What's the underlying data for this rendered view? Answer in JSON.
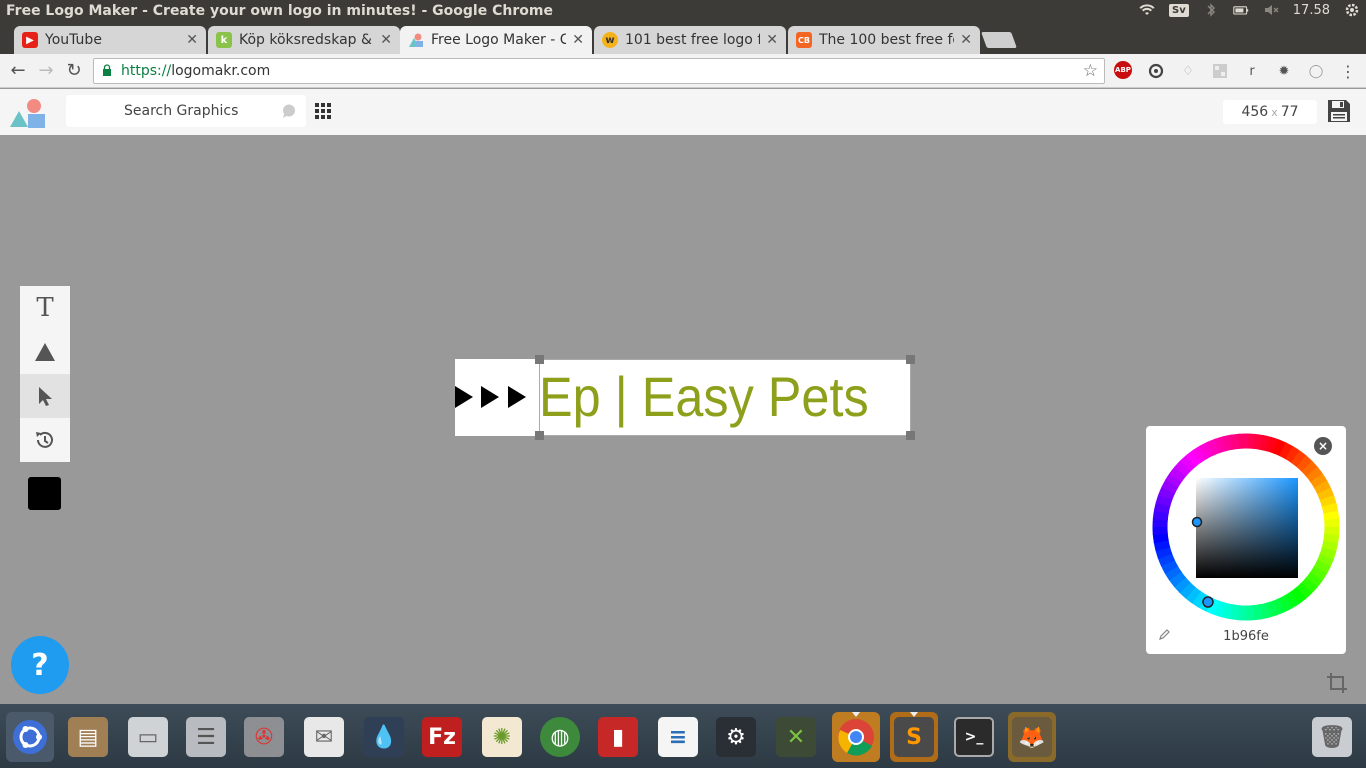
{
  "os": {
    "window_title": "Free Logo Maker - Create your own logo in minutes! - Google Chrome",
    "keyboard_layout": "Sv",
    "clock": "17.58"
  },
  "tabs": [
    {
      "label": "YouTube",
      "favicon": "youtube-icon",
      "color": "#e62117",
      "active": false
    },
    {
      "label": "Köp köksredskap &",
      "favicon": "k-icon",
      "color": "#8bc34a",
      "active": false
    },
    {
      "label": "Free Logo Maker - C",
      "favicon": "logomakr-icon",
      "color": "#f5f5f5",
      "active": true
    },
    {
      "label": "101 best free logo f",
      "favicon": "w-icon",
      "color": "#f6b21b",
      "active": false
    },
    {
      "label": "The 100 best free fo",
      "favicon": "cb-icon",
      "color": "#f26522",
      "active": false
    }
  ],
  "address_bar": {
    "scheme": "https://",
    "host": "logomakr.com"
  },
  "app": {
    "search_placeholder": "Search Graphics",
    "canvas_width": "456",
    "canvas_height": "77",
    "size_separator": "x",
    "logo_text": "Ep | Easy Pets",
    "logo_text_color": "#8ea01b",
    "help_label": "?",
    "swatch_color": "#000000"
  },
  "color_picker": {
    "hex": "1b96fe",
    "close_label": "×"
  },
  "dock_apps": [
    "ubuntu-dash-icon",
    "files-icon",
    "disk-icon",
    "server-icon",
    "settings-tools-icon",
    "mail-icon",
    "droplet-icon",
    "filezilla-icon",
    "brightness-icon",
    "globe-icon",
    "book-icon",
    "writer-icon",
    "steam-icon",
    "xmind-icon",
    "chrome-icon",
    "sublime-icon",
    "terminal-icon",
    "gimp-icon",
    "trash-icon"
  ]
}
